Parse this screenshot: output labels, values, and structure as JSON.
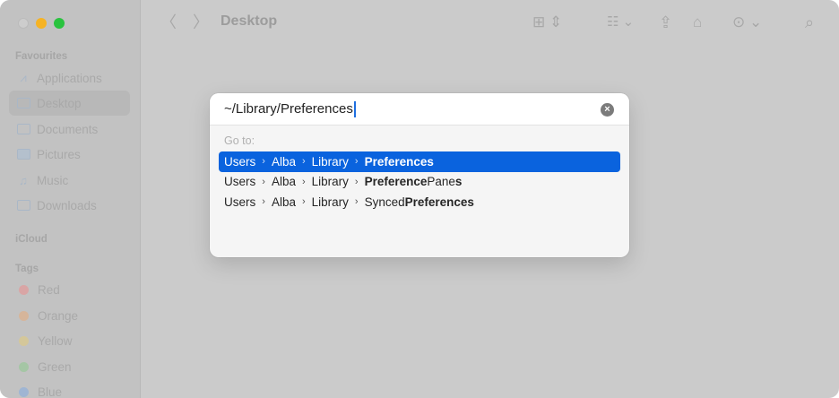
{
  "window": {
    "title": "Desktop",
    "traffic_lights": {
      "close": "#cdcdcd",
      "minimize": "#f6b324",
      "zoom": "#2ac33f"
    }
  },
  "sidebar": {
    "favourites_label": "Favourites",
    "favourites": [
      {
        "label": "Applications",
        "icon": "applications-icon"
      },
      {
        "label": "Desktop",
        "icon": "folder-icon",
        "selected": true
      },
      {
        "label": "Documents",
        "icon": "folder-icon"
      },
      {
        "label": "Pictures",
        "icon": "pictures-icon"
      },
      {
        "label": "Music",
        "icon": "music-icon"
      },
      {
        "label": "Downloads",
        "icon": "folder-icon"
      }
    ],
    "icloud_label": "iCloud",
    "tags_label": "Tags",
    "tags": [
      {
        "label": "Red",
        "color": "#d9a5a5"
      },
      {
        "label": "Orange",
        "color": "#d6b59a"
      },
      {
        "label": "Yellow",
        "color": "#d4c79a"
      },
      {
        "label": "Green",
        "color": "#a5c6a5"
      },
      {
        "label": "Blue",
        "color": "#9fb5d3"
      }
    ]
  },
  "toolbar": {
    "icons": [
      "back-icon",
      "forward-icon",
      "icon-view-icon",
      "group-icon",
      "share-icon",
      "tag-icon",
      "more-icon",
      "search-icon"
    ]
  },
  "goto_dialog": {
    "path_value": "~/Library/Preferences",
    "goto_label": "Go to:",
    "separator": "›",
    "results": [
      {
        "crumbs": [
          "Users",
          "Alba",
          "Library"
        ],
        "last": [
          {
            "t": "Preferences",
            "b": true
          }
        ],
        "selected": true
      },
      {
        "crumbs": [
          "Users",
          "Alba",
          "Library"
        ],
        "last": [
          {
            "t": "Preference",
            "b": true
          },
          {
            "t": "Pane",
            "b": false
          },
          {
            "t": "s",
            "b": true
          }
        ]
      },
      {
        "crumbs": [
          "Users",
          "Alba",
          "Library"
        ],
        "last": [
          {
            "t": "Synced",
            "b": false
          },
          {
            "t": "Preferences",
            "b": true
          }
        ]
      }
    ]
  }
}
